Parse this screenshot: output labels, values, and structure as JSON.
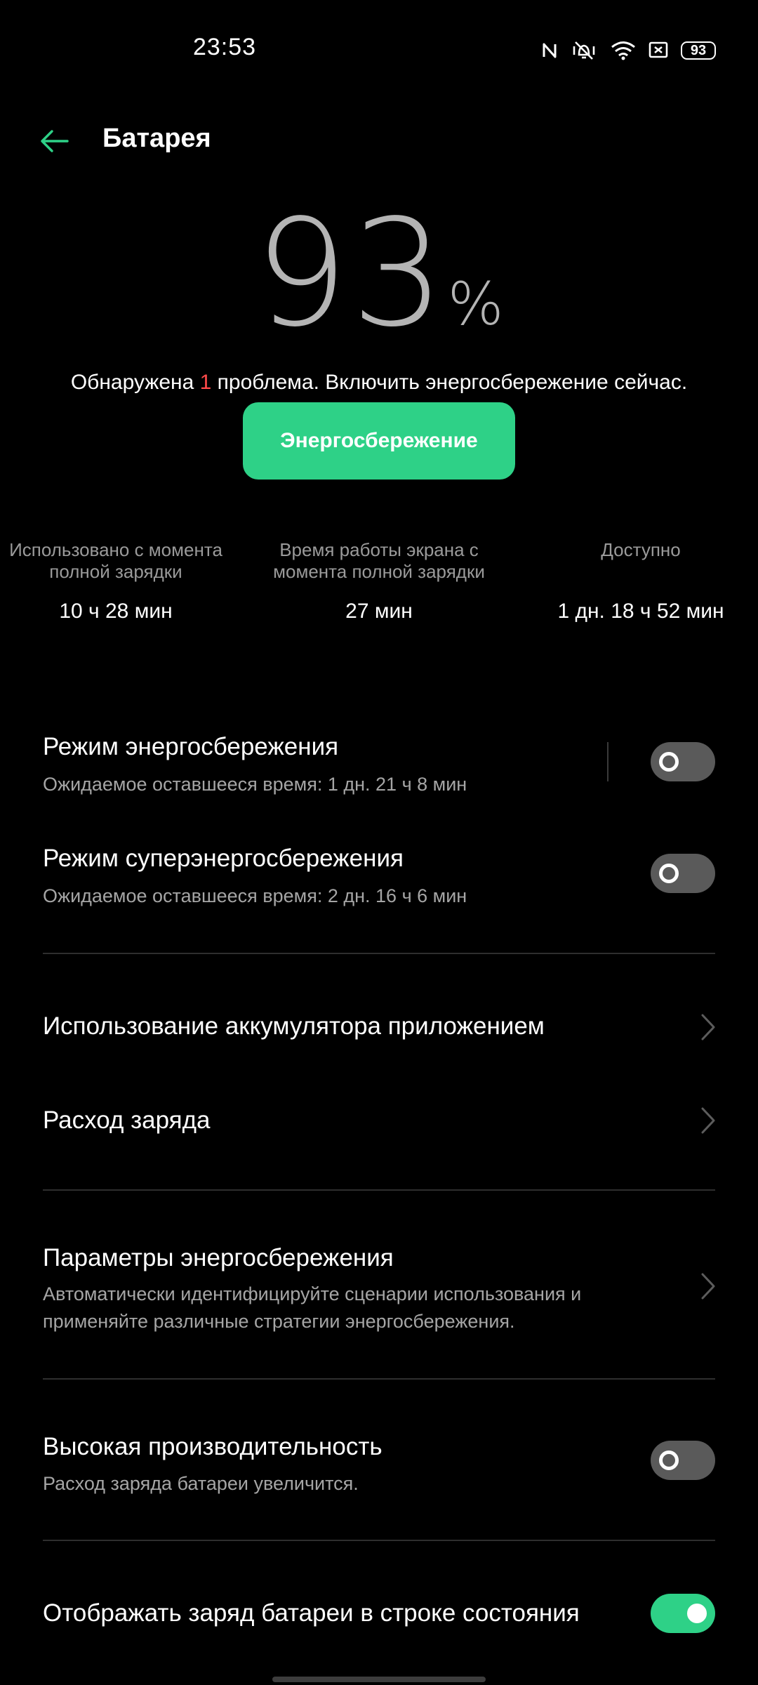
{
  "status_bar": {
    "time": "23:53",
    "battery_level": "93"
  },
  "header": {
    "title": "Батарея"
  },
  "summary": {
    "percent_value": "93",
    "percent_sign": "%",
    "issue_prefix": "Обнаружена ",
    "issue_count": "1",
    "issue_suffix": " проблема. Включить энергосбережение сейчас.",
    "saver_button_label": "Энергосбережение"
  },
  "stats": [
    {
      "label": "Использовано с момента полной зарядки",
      "value": "10 ч 28 мин"
    },
    {
      "label": "Время работы экрана с момента полной зарядки",
      "value": "27 мин"
    },
    {
      "label": "Доступно",
      "value": "1 дн. 18 ч 52 мин"
    }
  ],
  "modes": {
    "power_saving": {
      "title": "Режим энергосбережения",
      "subtitle": "Ожидаемое оставшееся время:  1 дн. 21 ч 8 мин",
      "enabled": false
    },
    "super_saving": {
      "title": "Режим суперэнергосбережения",
      "subtitle": "Ожидаемое оставшееся время:  2 дн. 16 ч 6 мин",
      "enabled": false
    }
  },
  "links": {
    "app_usage": "Использование аккумулятора приложением",
    "charge_consumption": "Расход заряда"
  },
  "saving_settings": {
    "title": "Параметры энергосбережения",
    "subtitle_line1": "Автоматически идентифицируйте сценарии использования и",
    "subtitle_line2": "применяйте различные стратегии энергосбережения."
  },
  "high_performance": {
    "title": "Высокая производительность",
    "subtitle": "Расход заряда батареи увеличится.",
    "enabled": false
  },
  "show_battery_status": {
    "title": "Отображать заряд батареи в строке состояния",
    "enabled": true
  },
  "colors": {
    "accent": "#2ed187",
    "alert": "#ff4a4a",
    "background": "#000000"
  }
}
